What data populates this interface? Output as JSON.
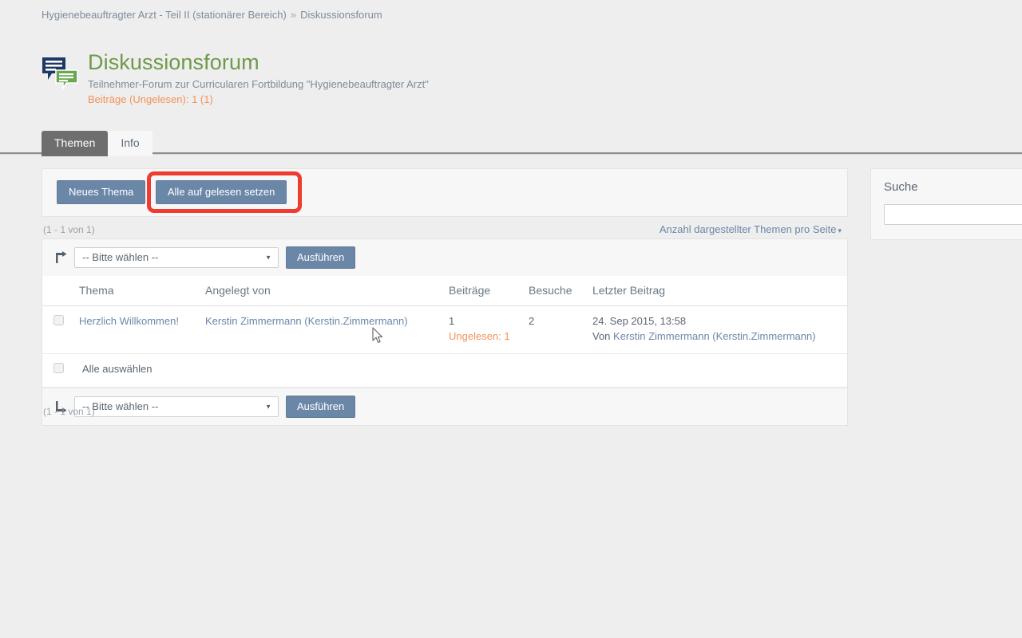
{
  "breadcrumb": {
    "parent": "Hygienebeauftragter Arzt - Teil II (stationärer Bereich)",
    "separator": "»",
    "current": "Diskussionsforum"
  },
  "header": {
    "icon": "forum-speech-bubbles-icon",
    "title": "Diskussionsforum",
    "subtitle": "Teilnehmer-Forum zur Curricularen Fortbildung \"Hygienebeauftragter Arzt\"",
    "meta": "Beiträge (Ungelesen): 1 (1)"
  },
  "tabs": [
    {
      "label": "Themen",
      "active": true
    },
    {
      "label": "Info",
      "active": false
    }
  ],
  "toolbar": {
    "new_topic_label": "Neues Thema",
    "mark_all_read_label": "Alle auf gelesen setzen",
    "highlight_color": "#ef3b30"
  },
  "pagination": {
    "top_count": "(1 - 1 von 1)",
    "bottom_count": "(1 - 1 von 1)",
    "per_page_label": "Anzahl dargestellter Themen pro Seite",
    "per_page_caret": "▾"
  },
  "action_bar_top": {
    "icon": "arrow-up-right-icon",
    "select_value": "-- Bitte wählen --",
    "select_caret": "▼",
    "run_label": "Ausführen"
  },
  "action_bar_bottom": {
    "icon": "arrow-down-right-icon",
    "select_value": "-- Bitte wählen --",
    "select_caret": "▼",
    "run_label": "Ausführen"
  },
  "table": {
    "columns": [
      "Thema",
      "Angelegt von",
      "Beiträge",
      "Besuche",
      "Letzter Beitrag"
    ],
    "rows": [
      {
        "checked": false,
        "thema": "Herzlich Willkommen!",
        "angelegt_von": "Kerstin Zimmermann (Kerstin.Zimmermann)",
        "beitraege": "1",
        "beitraege_unread": "Ungelesen: 1",
        "besuche": "2",
        "letzter_beitrag_datum": "24. Sep 2015, 13:58",
        "letzter_beitrag_von_prefix": "Von ",
        "letzter_beitrag_von": "Kerstin Zimmermann (Kerstin.Zimmermann)"
      }
    ],
    "select_all_label": "Alle auswählen"
  },
  "search_panel": {
    "title": "Suche",
    "input_value": "",
    "input_placeholder": ""
  },
  "colors": {
    "title_green": "#6f9a49",
    "link_blue": "#6b87a8",
    "unread_orange": "#f29259",
    "active_tab_gray": "#6e6e6e",
    "page_background": "#eeeeee"
  }
}
